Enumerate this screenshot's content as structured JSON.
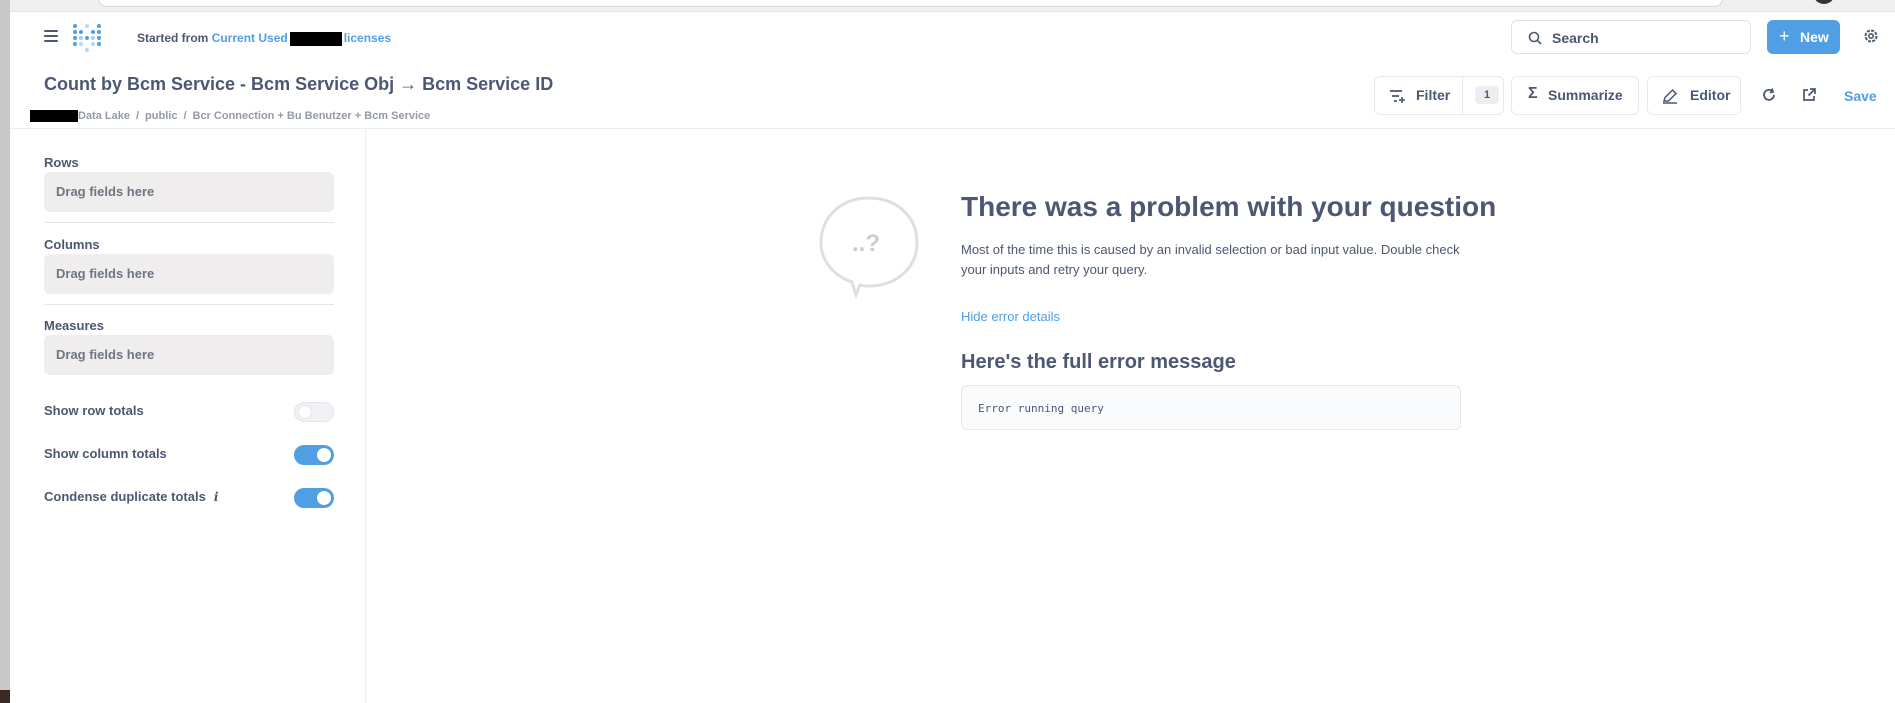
{
  "nav": {
    "started_prefix": "Started from",
    "source_link_start": "Current Used",
    "source_link_end": "licenses",
    "search_label": "Search",
    "new_label": "New"
  },
  "header": {
    "title": "Count by Bcm Service - Bcm Service Obj → Bcm Service ID",
    "breadcrumb": [
      "Data Lake",
      "public",
      "Bcr Connection + Bu Benutzer + Bcm Service"
    ],
    "breadcrumb_sep": "/",
    "filter_label": "Filter",
    "filter_count": "1",
    "summarize_label": "Summarize",
    "editor_label": "Editor",
    "save_label": "Save"
  },
  "sidebar": {
    "rows_label": "Rows",
    "columns_label": "Columns",
    "measures_label": "Measures",
    "dropzone_text": "Drag fields here",
    "toggles": [
      {
        "label": "Show row totals",
        "on": false
      },
      {
        "label": "Show column totals",
        "on": true
      },
      {
        "label": "Condense duplicate totals",
        "on": true
      }
    ],
    "info_glyph": "i"
  },
  "error": {
    "title": "There was a problem with your question",
    "description": "Most of the time this is caused by an invalid selection or bad input value. Double check your inputs and retry your query.",
    "toggle_link": "Hide error details",
    "full_title": "Here's the full error message",
    "message": "Error running query",
    "bubble_glyph": "..?"
  },
  "colors": {
    "brand": "#509ee3",
    "text": "#4c5773",
    "muted": "#949aab"
  }
}
